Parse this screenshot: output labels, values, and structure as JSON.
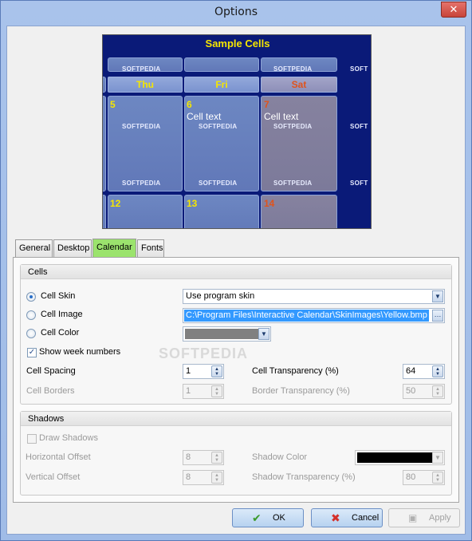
{
  "window": {
    "title": "Options",
    "close_glyph": "✕"
  },
  "preview": {
    "title": "Sample Cells",
    "days": [
      "Thu",
      "Fri",
      "Sat"
    ],
    "cells": [
      {
        "num": "5",
        "text": ""
      },
      {
        "num": "6",
        "text": "Cell text"
      },
      {
        "num": "7",
        "text": "Cell text"
      },
      {
        "num": "12",
        "text": ""
      },
      {
        "num": "13",
        "text": ""
      },
      {
        "num": "14",
        "text": ""
      }
    ],
    "watermark": "SOFTPEDIA",
    "watermark_cut": "SOFT",
    "colors": {
      "background": "#0a1a78",
      "day_number": "#f5e600",
      "saturday": "#e0531c"
    }
  },
  "tabs": [
    {
      "label": "General",
      "active": false
    },
    {
      "label": "Desktop",
      "active": false
    },
    {
      "label": "Calendar",
      "active": true
    },
    {
      "label": "Fonts",
      "active": false
    }
  ],
  "cells_group": {
    "header": "Cells",
    "cell_skin": {
      "label": "Cell Skin",
      "selected": true,
      "value": "Use program skin"
    },
    "cell_image": {
      "label": "Cell Image",
      "selected": false,
      "value": "C:\\Program Files\\Interactive Calendar\\SkinImages\\Yellow.bmp"
    },
    "cell_color": {
      "label": "Cell Color",
      "selected": false,
      "value": "#808080"
    },
    "show_week_numbers": {
      "label": "Show week numbers",
      "checked": true
    },
    "cell_spacing": {
      "label": "Cell Spacing",
      "value": "1"
    },
    "cell_transparency": {
      "label": "Cell Transparency (%)",
      "value": "64"
    },
    "cell_borders": {
      "label": "Cell Borders",
      "value": "1",
      "enabled": false
    },
    "border_transparency": {
      "label": "Border Transparency (%)",
      "value": "50",
      "enabled": false
    }
  },
  "shadows_group": {
    "header": "Shadows",
    "draw_shadows": {
      "label": "Draw Shadows",
      "checked": false,
      "enabled": false
    },
    "horizontal_offset": {
      "label": "Horizontal Offset",
      "value": "8",
      "enabled": false
    },
    "shadow_color": {
      "label": "Shadow Color",
      "value": "#000000",
      "enabled": false
    },
    "vertical_offset": {
      "label": "Vertical Offset",
      "value": "8",
      "enabled": false
    },
    "shadow_transparency": {
      "label": "Shadow Transparency (%)",
      "value": "80",
      "enabled": false
    }
  },
  "buttons": {
    "ok": {
      "label": "OK",
      "icon": "checkmark-icon"
    },
    "cancel": {
      "label": "Cancel",
      "icon": "x-icon"
    },
    "apply": {
      "label": "Apply",
      "icon": "floppy-icon",
      "enabled": false
    }
  },
  "watermark_overlay": "SOFTPEDIA"
}
